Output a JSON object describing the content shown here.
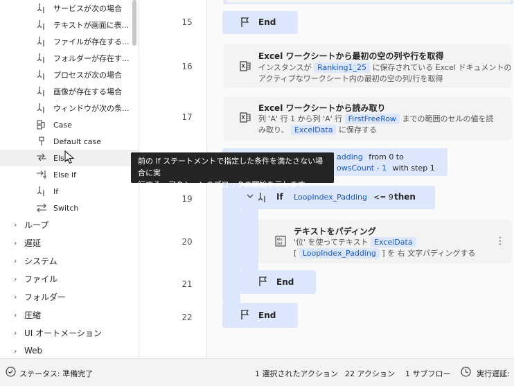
{
  "sidebar": {
    "sub_items": [
      {
        "label": "サービスが次の場合",
        "icon": "condition-icon"
      },
      {
        "label": "テキストが画面に表...",
        "icon": "condition-icon"
      },
      {
        "label": "ファイルが存在する...",
        "icon": "condition-icon"
      },
      {
        "label": "フォルダーが存在す...",
        "icon": "condition-icon"
      },
      {
        "label": "プロセスが次の場合",
        "icon": "condition-icon"
      },
      {
        "label": "画像が存在する場合",
        "icon": "condition-icon"
      },
      {
        "label": "ウィンドウが次の条...",
        "icon": "condition-icon"
      },
      {
        "label": "Case",
        "icon": "case-icon"
      },
      {
        "label": "Default case",
        "icon": "default-case-icon"
      },
      {
        "label": "Else",
        "icon": "else-icon"
      },
      {
        "label": "Else if",
        "icon": "else-if-icon"
      },
      {
        "label": "If",
        "icon": "if-icon"
      },
      {
        "label": "Switch",
        "icon": "switch-icon"
      }
    ],
    "categories": [
      "ループ",
      "遅延",
      "システム",
      "ファイル",
      "フォルダー",
      "圧縮",
      "UI オートメーション",
      "Web"
    ]
  },
  "tooltip": {
    "line1": "前の If ステートメントで指定した条件を満たさない場合に実",
    "line2": "行する、アクションのブロックの開始を示します"
  },
  "flow": {
    "line_numbers": [
      "15",
      "16",
      "17",
      "19",
      "20",
      "21",
      "22"
    ],
    "end_label": "End",
    "step16": {
      "title": "Excel ワークシートから最初の空の列や行を取得",
      "d1a": "インスタンスが",
      "chip1": "Ranking1_25",
      "d1b": "に保存されている Excel ドキュメントの",
      "d2": "アクティブなワークシート内の最初の空の列/行を取得"
    },
    "step17": {
      "title": "Excel ワークシートから読み取り",
      "d1a": "列 'A' 行 1 から列 'A' 行",
      "chip1": "FirstFreeRow",
      "d1b": "までの範囲のセルの値を読",
      "d2a": "み取り、",
      "chip2": "ExcelData",
      "d2b": "に保存する"
    },
    "step18": {
      "chip_partial": "adding",
      "from_text": "from 0 to",
      "chip2_partial": "owsCount - 1",
      "step_text": "with step 1"
    },
    "step19": {
      "keyword": "If",
      "chip": "LoopIndex_Padding",
      "op": "<= 9",
      "then": "then"
    },
    "step20": {
      "title": "テキストをパディング",
      "d1a": "'位' を使ってテキスト",
      "chip1": "ExcelData",
      "d2a": "[",
      "chip2": "LoopIndex_Padding",
      "d2b": "] を 右 文字パディングする"
    }
  },
  "status": {
    "status_text": "ステータス: 準備完了",
    "selected": "1 選択されたアクション",
    "actions": "22 アクション",
    "subflows": "1 サブフロー",
    "exec_delay": "実行遅延:"
  },
  "colors": {
    "accent": "#dde7fb",
    "chip_text": "#1a56b8",
    "tooltip_bg": "#242424"
  }
}
